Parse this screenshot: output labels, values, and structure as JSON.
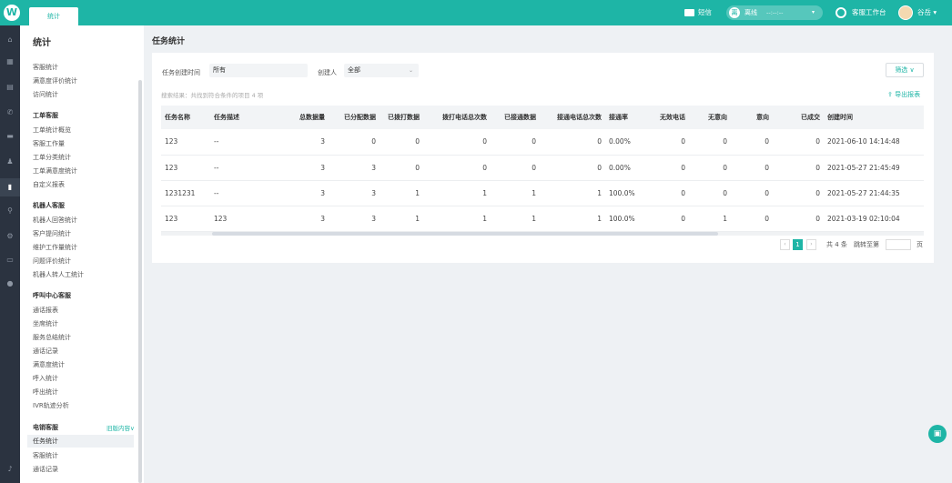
{
  "topbar": {
    "logo": "W",
    "tab": "统计",
    "sms": "短信",
    "status_badge": "离",
    "status": "离线",
    "status_time": "--:--:--",
    "workstation": "客服工作台",
    "user": "谷岳 ▾"
  },
  "sidebar": {
    "title": "统计",
    "items_top": [
      "客服统计",
      "满意度评价统计",
      "访问统计"
    ],
    "groups": [
      {
        "title": "工单客服",
        "items": [
          "工单统计概览",
          "客服工作量",
          "工单分类统计",
          "工单满意度统计",
          "自定义报表"
        ]
      },
      {
        "title": "机器人客服",
        "items": [
          "机器人回答统计",
          "客户提问统计",
          "维护工作量统计",
          "问题评价统计",
          "机器人转人工统计"
        ]
      },
      {
        "title": "呼叫中心客服",
        "items": [
          "通话报表",
          "坐席统计",
          "服务总结统计",
          "通话记录",
          "满意度统计",
          "呼入统计",
          "呼出统计",
          "IVR轨迹分析"
        ]
      },
      {
        "title": "电销客服",
        "toggle": "旧版内容",
        "items": [
          "任务统计",
          "客服统计",
          "通话记录"
        ]
      }
    ]
  },
  "main": {
    "page_title": "任务统计",
    "filters": {
      "created_time_label": "任务创建时间",
      "created_time_value": "所有",
      "creator_label": "创建人",
      "creator_value": "全部",
      "filter_button": "筛选 ∨"
    },
    "search_result": "搜索结果：共找到符合条件的项目 4 项",
    "export": "导出报表",
    "table": {
      "headers": [
        "任务名称",
        "任务描述",
        "总数据量",
        "已分配数据",
        "已拨打数据",
        "拨打电话总次数",
        "已接通数据",
        "接通电话总次数",
        "接通率",
        "无效电话",
        "无意向",
        "意向",
        "已成交",
        "创建时间"
      ],
      "rows": [
        [
          "123",
          "--",
          "3",
          "0",
          "0",
          "0",
          "0",
          "0",
          "0.00%",
          "0",
          "0",
          "0",
          "0",
          "2021-06-10 14:14:48"
        ],
        [
          "123",
          "--",
          "3",
          "3",
          "0",
          "0",
          "0",
          "0",
          "0.00%",
          "0",
          "0",
          "0",
          "0",
          "2021-05-27 21:45:49"
        ],
        [
          "1231231",
          "--",
          "3",
          "3",
          "1",
          "1",
          "1",
          "1",
          "100.0%",
          "0",
          "0",
          "0",
          "0",
          "2021-05-27 21:44:35"
        ],
        [
          "123",
          "123",
          "3",
          "3",
          "1",
          "1",
          "1",
          "1",
          "100.0%",
          "0",
          "1",
          "0",
          "0",
          "2021-03-19 02:10:04"
        ]
      ]
    },
    "pagination": {
      "prev": "‹",
      "page": "1",
      "next": "›",
      "total": "共 4 条",
      "jump_label": "跳转至第",
      "page_unit": "页"
    }
  },
  "chat_fab_icon": "chat-icon"
}
